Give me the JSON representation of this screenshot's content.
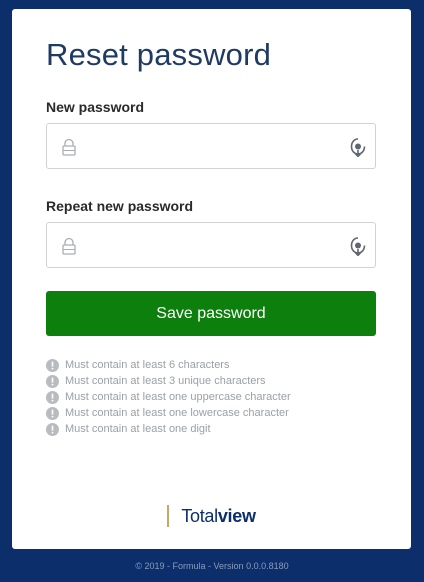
{
  "form": {
    "title": "Reset password",
    "new_password": {
      "label": "New password",
      "value": "",
      "placeholder": ""
    },
    "repeat_password": {
      "label": "Repeat new password",
      "value": "",
      "placeholder": ""
    },
    "save_label": "Save password"
  },
  "requirements": [
    "Must contain at least 6 characters",
    "Must contain at least 3 unique characters",
    "Must contain at least one uppercase character",
    "Must contain at least one lowercase character",
    "Must contain at least one digit"
  ],
  "brand": {
    "light": "Total",
    "bold": "view"
  },
  "footer": {
    "text": "© 2019 - Formula - Version 0.0.0.8180"
  },
  "icons": {
    "field_prefix": "lock-icon",
    "field_suffix": "show-password-icon",
    "requirement": "exclamation-circle-icon"
  },
  "colors": {
    "background": "#0c2e6b",
    "primary_button": "#0d7f0d",
    "brand_accent": "#c9a567"
  }
}
